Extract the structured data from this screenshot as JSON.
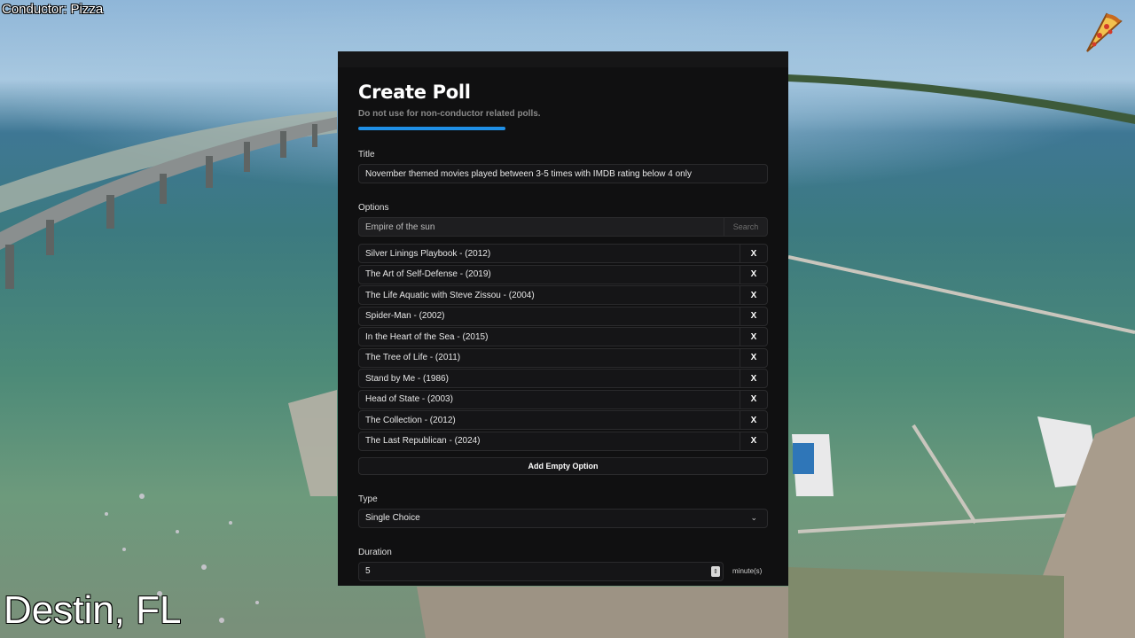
{
  "overlay": {
    "conductor": "Conductor: Pizza",
    "location": "Destin, FL"
  },
  "modal": {
    "title": "Create Poll",
    "subtitle": "Do not use for non-conductor related polls.",
    "progress": 0.36,
    "title_label": "Title",
    "title_value": "November themed movies played between 3-5 times with IMDB rating below 4 only",
    "options_label": "Options",
    "search_value": "Empire of the sun",
    "search_button": "Search",
    "options": [
      "Silver Linings Playbook - (2012)",
      "The Art of Self-Defense - (2019)",
      "The Life Aquatic with Steve Zissou - (2004)",
      "Spider-Man - (2002)",
      "In the Heart of the Sea - (2015)",
      "The Tree of Life - (2011)",
      "Stand by Me - (1986)",
      "Head of State - (2003)",
      "The Collection - (2012)",
      "The Last Republican - (2024)"
    ],
    "remove_label": "X",
    "add_empty_option": "Add Empty Option",
    "type_label": "Type",
    "type_value": "Single Choice",
    "duration_label": "Duration",
    "duration_value": "5",
    "duration_unit": "minute(s)"
  },
  "icons": {
    "pizza": "pizza-icon",
    "dropdown": "chevron-down-icon"
  },
  "colors": {
    "accent": "#1f8fe6",
    "modal_bg": "#101011"
  }
}
